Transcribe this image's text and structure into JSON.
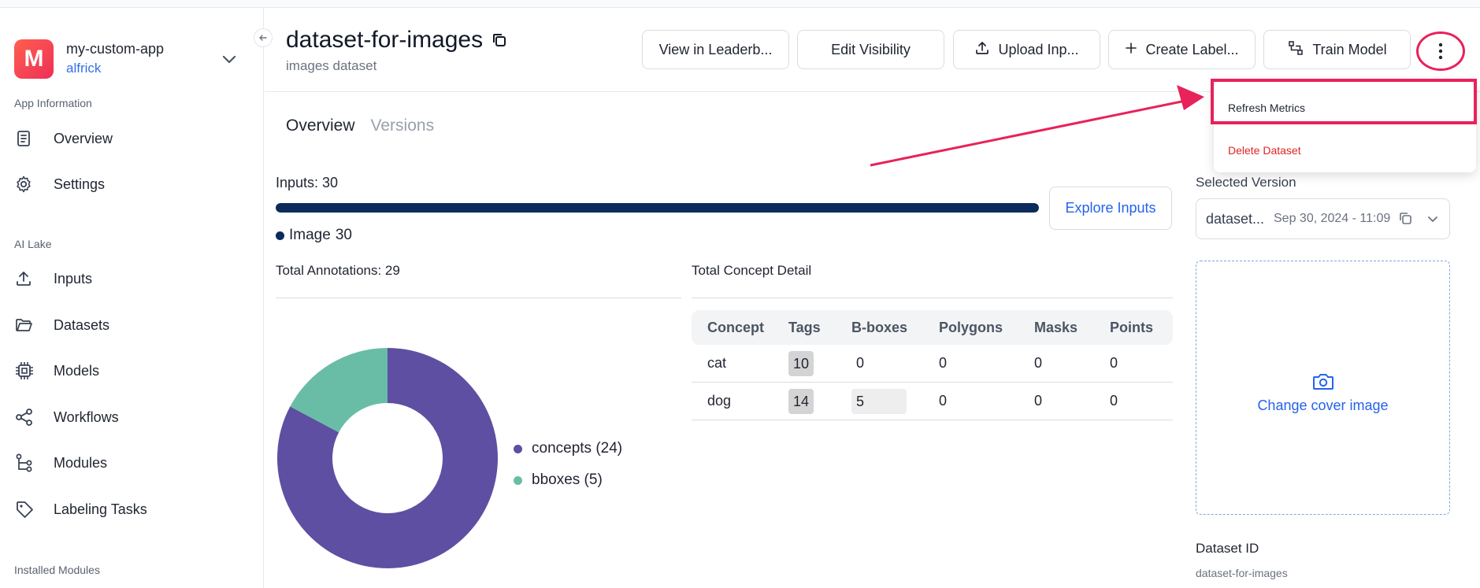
{
  "app": {
    "avatar_letter": "M",
    "name": "my-custom-app",
    "user": "alfrick"
  },
  "sidebar": {
    "sections": [
      {
        "label": "App Information"
      },
      {
        "label": "AI Lake"
      },
      {
        "label": "Installed Modules"
      }
    ],
    "items": [
      {
        "label": "Overview",
        "icon": "document-icon"
      },
      {
        "label": "Settings",
        "icon": "gear-icon"
      },
      {
        "label": "Inputs",
        "icon": "upload-icon"
      },
      {
        "label": "Datasets",
        "icon": "folder-icon"
      },
      {
        "label": "Models",
        "icon": "chip-icon"
      },
      {
        "label": "Workflows",
        "icon": "share-icon"
      },
      {
        "label": "Modules",
        "icon": "tree-icon"
      },
      {
        "label": "Labeling Tasks",
        "icon": "tag-icon"
      }
    ]
  },
  "header": {
    "title": "dataset-for-images",
    "subtitle": "images dataset",
    "buttons": {
      "leaderboard": "View in Leaderb...",
      "visibility": "Edit Visibility",
      "upload": "Upload Inp...",
      "labels": "Create Label...",
      "train": "Train Model"
    }
  },
  "tabs": [
    {
      "label": "Overview"
    },
    {
      "label": "Versions"
    }
  ],
  "inputs": {
    "title": "Inputs: 30",
    "fill_fraction": 1.0,
    "legend_label": "Image",
    "legend_count": "30",
    "explore_label": "Explore Inputs"
  },
  "annotations": {
    "title": "Total Annotations: 29",
    "chart_data": {
      "type": "pie",
      "categories": [
        "concepts (24)",
        "bboxes (5)"
      ],
      "values": [
        24,
        5
      ],
      "colors": [
        "#5e4fa2",
        "#69bda7"
      ]
    }
  },
  "concepts": {
    "title": "Total Concept Detail",
    "headers": [
      "Concept",
      "Tags",
      "B-boxes",
      "Polygons",
      "Masks",
      "Points"
    ],
    "rows": [
      [
        "cat",
        "10",
        "0",
        "0",
        "0",
        "0"
      ],
      [
        "dog",
        "14",
        "5",
        "0",
        "0",
        "0"
      ]
    ]
  },
  "version": {
    "label": "Selected Version",
    "name": "dataset...",
    "date": "Sep 30, 2024 - 11:09"
  },
  "cover": {
    "label": "Change cover image"
  },
  "dataset_id": {
    "label": "Dataset ID",
    "value": "dataset-for-images"
  },
  "menu": {
    "refresh": "Refresh Metrics",
    "delete": "Delete Dataset"
  },
  "colors": {
    "accent": "#2563eb",
    "highlight": "#e8225a",
    "progress": "#0b2b5c",
    "danger": "#e02424"
  }
}
